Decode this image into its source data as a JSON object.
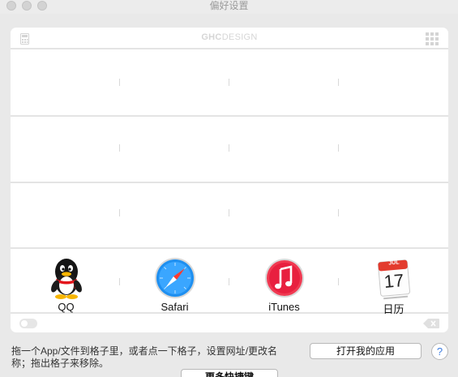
{
  "window": {
    "title": "偏好设置"
  },
  "panel": {
    "brand_bold": "GHC",
    "brand_rest": "DESIGN"
  },
  "dock": {
    "apps": [
      {
        "label": "QQ",
        "icon": "qq-penguin-icon"
      },
      {
        "label": "Safari",
        "icon": "safari-compass-icon"
      },
      {
        "label": "iTunes",
        "icon": "itunes-note-icon"
      },
      {
        "label": "日历",
        "icon": "calendar-icon",
        "month": "JUL",
        "day": "17"
      }
    ]
  },
  "footer": {
    "hint": "拖一个App/文件到格子里，或者点一下格子，设置网址/更改名称；拖出格子来移除。",
    "open_label": "打开我的应用",
    "help_label": "?",
    "more_label": "更多快捷键"
  },
  "colors": {
    "window_bg": "#e9e9e9",
    "panel_bg": "#ffffff",
    "divider": "#e4e4e4",
    "accent": "#3b7be0"
  }
}
